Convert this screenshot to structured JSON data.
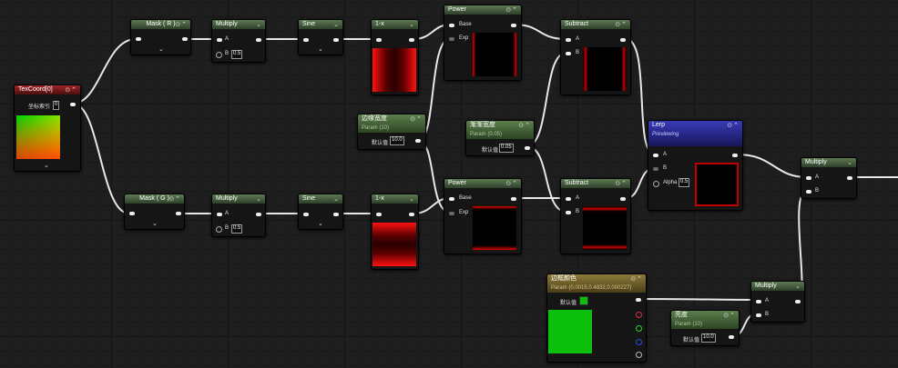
{
  "graph": {
    "colors": {
      "wire": "#e8e8e8",
      "green_header": "#5d7a52",
      "red_header": "#a12424",
      "blue_header": "#3a3ab8",
      "gold_header": "#8d7b3a"
    },
    "nodes": {
      "texcoord": {
        "title": "TexCoord[0]",
        "param_label": "坐标索引",
        "param_value": "0"
      },
      "mask_r": {
        "title": "Mask ( R )"
      },
      "mask_g": {
        "title": "Mask ( G )"
      },
      "multiply_top": {
        "title": "Multiply",
        "pin_a": "A",
        "pin_b": "B",
        "b_value": "0.5"
      },
      "multiply_bottom": {
        "title": "Multiply",
        "pin_a": "A",
        "pin_b": "B",
        "b_value": "0.5"
      },
      "sine_top": {
        "title": "Sine"
      },
      "sine_bottom": {
        "title": "Sine"
      },
      "one_minus_top": {
        "title": "1-x"
      },
      "one_minus_bottom": {
        "title": "1-x"
      },
      "power_top": {
        "title": "Power",
        "pin_base": "Base",
        "pin_exp": "Exp"
      },
      "power_bottom": {
        "title": "Power",
        "pin_base": "Base",
        "pin_exp": "Exp"
      },
      "edge_width": {
        "title": "边缘宽度",
        "subtitle": "Param (10)",
        "default_label": "默认值",
        "default_value": "10.0"
      },
      "gradient_width": {
        "title": "渐渐宽度",
        "subtitle": "Param (0.05)",
        "default_label": "默认值",
        "default_value": "0.05"
      },
      "subtract_top": {
        "title": "Subtract",
        "pin_a": "A",
        "pin_b": "B"
      },
      "subtract_bottom": {
        "title": "Subtract",
        "pin_a": "A",
        "pin_b": "B"
      },
      "lerp": {
        "title": "Lerp",
        "subtitle": "Previewing",
        "pin_a": "A",
        "pin_b": "B",
        "pin_alpha": "Alpha",
        "alpha_value": "0.5"
      },
      "multiply_right": {
        "title": "Multiply",
        "pin_a": "A",
        "pin_b": "B"
      },
      "edge_color": {
        "title": "边框颜色",
        "subtitle": "Param (0.0015,0.4832,0.000227)",
        "default_label": "默认值",
        "swatch_color": "#0bbf0b"
      },
      "brightness": {
        "title": "亮度",
        "subtitle": "Param (10)",
        "default_label": "默认值",
        "default_value": "10.0"
      },
      "multiply_mid": {
        "title": "Multiply",
        "pin_a": "A",
        "pin_b": "B"
      }
    }
  }
}
